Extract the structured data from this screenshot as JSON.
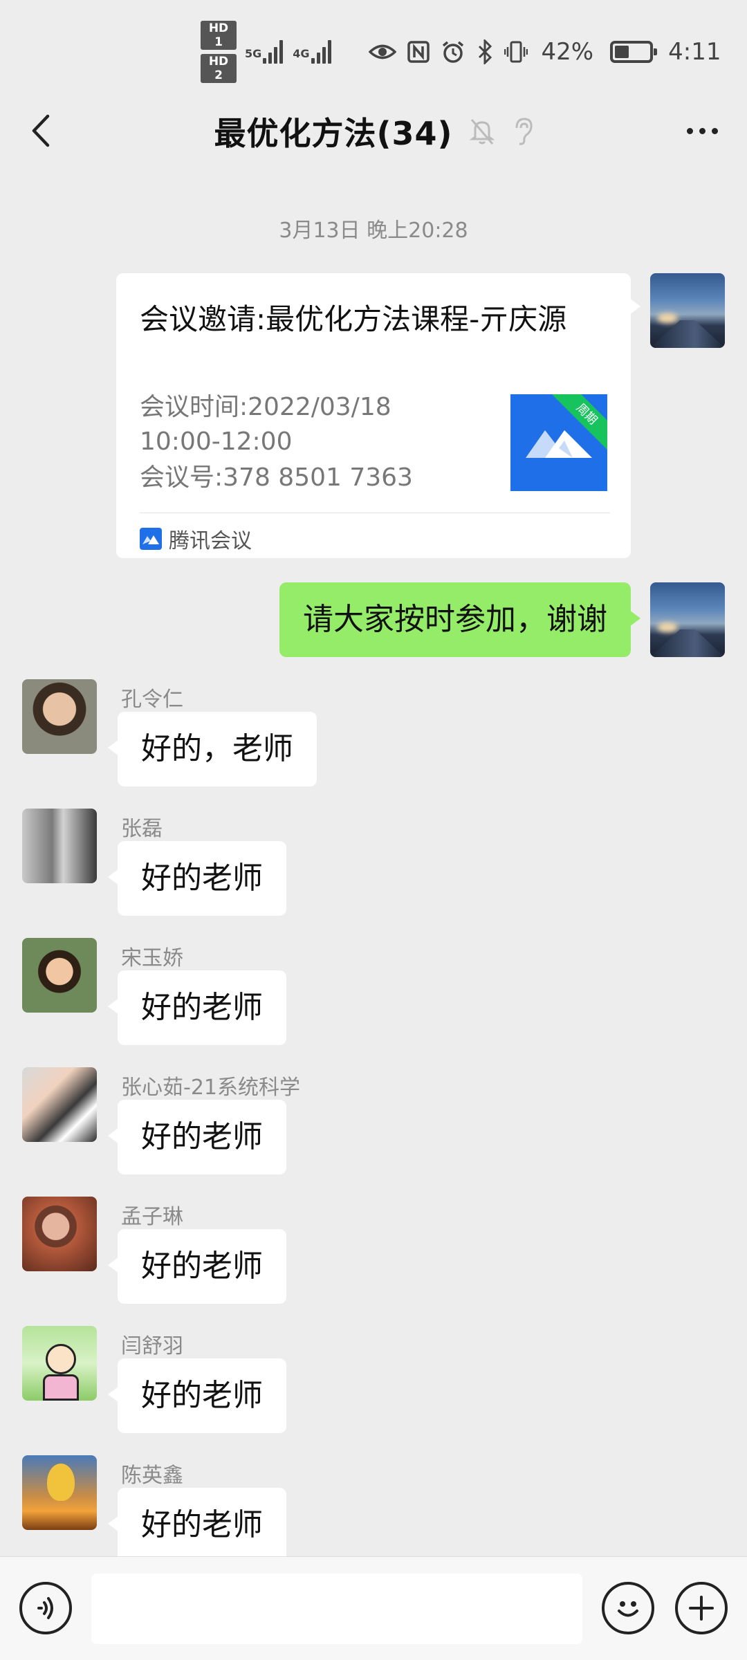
{
  "status_bar": {
    "sim1": "HD 1",
    "sim2": "HD 2",
    "net1": "5G",
    "net2": "4G",
    "battery_percent": "42%",
    "battery_level": 0.42,
    "time": "4:11",
    "icons": [
      "signal-icon",
      "wifi-icon",
      "eye-icon",
      "nfc-icon",
      "alarm-icon",
      "bluetooth-icon",
      "vibrate-icon",
      "battery-icon"
    ]
  },
  "header": {
    "title": "最优化方法(34)",
    "icons": [
      "back-icon",
      "mute-bell-icon",
      "ear-icon",
      "more-icon"
    ]
  },
  "timestamp": "3月13日 晚上20:28",
  "meeting_card": {
    "title": "会议邀请:最优化方法课程-亓庆源",
    "time_line1": "会议时间:2022/03/18",
    "time_line2": "10:00-12:00",
    "meeting_id": "会议号:378 8501 7363",
    "badge": "周期",
    "source": "腾讯会议"
  },
  "my_message": "请大家按时参加，谢谢",
  "messages": [
    {
      "sender": "孔令仁",
      "text": "好的，老师"
    },
    {
      "sender": "张磊",
      "text": "好的老师"
    },
    {
      "sender": "宋玉娇",
      "text": "好的老师"
    },
    {
      "sender": "张心茹-21系统科学",
      "text": "好的老师"
    },
    {
      "sender": "孟子琳",
      "text": "好的老师"
    },
    {
      "sender": "闫舒羽",
      "text": "好的老师"
    },
    {
      "sender": "陈英鑫",
      "text": "好的老师"
    }
  ],
  "input": {
    "value": "",
    "placeholder": ""
  },
  "colors": {
    "background": "#ededed",
    "my_bubble": "#95ec69",
    "other_bubble": "#ffffff",
    "tencent_meeting_blue": "#1f6fe8"
  }
}
